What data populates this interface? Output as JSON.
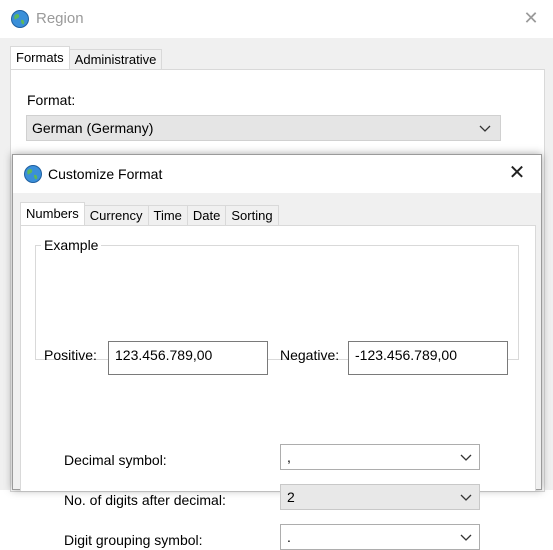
{
  "region_window": {
    "title": "Region",
    "close_glyph": "✕",
    "tabs": [
      {
        "label": "Formats",
        "active": true
      },
      {
        "label": "Administrative",
        "active": false
      }
    ],
    "format_label": "Format:",
    "format_value": "German (Germany)"
  },
  "customize_dialog": {
    "title": "Customize Format",
    "close_glyph": "✕",
    "tabs": [
      {
        "label": "Numbers",
        "active": true
      },
      {
        "label": "Currency",
        "active": false
      },
      {
        "label": "Time",
        "active": false
      },
      {
        "label": "Date",
        "active": false
      },
      {
        "label": "Sorting",
        "active": false
      }
    ],
    "example": {
      "legend": "Example",
      "positive_label": "Positive:",
      "positive_value": "123.456.789,00",
      "negative_label": "Negative:",
      "negative_value": "-123.456.789,00"
    },
    "settings": [
      {
        "label": "Decimal symbol:",
        "value": ",",
        "editable": true
      },
      {
        "label": "No. of digits after decimal:",
        "value": "2",
        "editable": false
      },
      {
        "label": "Digit grouping symbol:",
        "value": ".",
        "editable": true
      }
    ]
  },
  "icons": {
    "app_icon": "globe-icon",
    "dropdown_icon": "chevron-down-icon",
    "close_icon": "close-icon"
  },
  "colors": {
    "window_bg": "#f0f0f0",
    "panel_bg": "#ffffff",
    "inactive_title": "#9a9a9a",
    "disabled_field": "#e5e5e5"
  }
}
